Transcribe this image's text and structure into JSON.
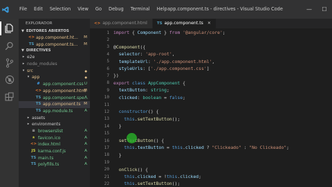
{
  "titlebar": {
    "menu": [
      "File",
      "Edit",
      "Selection",
      "View",
      "Go",
      "Debug",
      "Terminal",
      "Help"
    ],
    "window_title": "app.component.ts - directives - Visual Studio Code",
    "controls": {
      "minimize": "—",
      "maximize": "☐",
      "close": "✕"
    }
  },
  "activity": [
    "files-icon",
    "search-icon",
    "source-control-icon",
    "debug-icon",
    "extensions-icon"
  ],
  "sidebar": {
    "title": "EXPLORADOR",
    "open_editors": {
      "label": "EDITORES ABIERTOS",
      "items": [
        {
          "name": "app.component.ht...",
          "badge": "M",
          "icon": "<>",
          "icon_color": "#e37933",
          "name_color": "#e2c08d"
        },
        {
          "name": "app.component.ts...",
          "badge": "M",
          "icon": "TS",
          "icon_color": "#519aba",
          "name_color": "#e2c08d"
        }
      ]
    },
    "project": {
      "label": "DIRECTIVES",
      "items": [
        {
          "name": "e2e",
          "type": "folder",
          "depth": 1,
          "badge": "",
          "name_color": "#cccccc"
        },
        {
          "name": "node_modules",
          "type": "folder",
          "depth": 1,
          "badge": "",
          "name_color": "#8c8c8c"
        },
        {
          "name": "src",
          "type": "folder-open",
          "depth": 1,
          "badge": "",
          "name_color": "#e2c08d",
          "dot": true
        },
        {
          "name": "app",
          "type": "folder-open",
          "depth": 2,
          "badge": "",
          "name_color": "#e2c08d",
          "dot": true
        },
        {
          "name": "app.component.css",
          "type": "css",
          "depth": 3,
          "badge": "U",
          "name_color": "#73c991"
        },
        {
          "name": "app.component.html",
          "type": "html",
          "depth": 3,
          "badge": "M",
          "name_color": "#e2c08d"
        },
        {
          "name": "app.component.spe...",
          "type": "ts",
          "depth": 3,
          "badge": "A",
          "name_color": "#73c991"
        },
        {
          "name": "app.component.ts",
          "type": "ts",
          "depth": 3,
          "badge": "M",
          "name_color": "#e2c08d",
          "selected": true
        },
        {
          "name": "app.module.ts",
          "type": "ts",
          "depth": 3,
          "badge": "A",
          "name_color": "#73c991"
        },
        {
          "name": "assets",
          "type": "folder",
          "depth": 2,
          "badge": "",
          "name_color": "#cccccc"
        },
        {
          "name": "environments",
          "type": "folder",
          "depth": 2,
          "badge": "",
          "name_color": "#cccccc"
        },
        {
          "name": "browserslist",
          "type": "txt",
          "depth": 2,
          "badge": "A",
          "name_color": "#73c991"
        },
        {
          "name": "favicon.ico",
          "type": "img",
          "depth": 2,
          "badge": "A",
          "name_color": "#73c991"
        },
        {
          "name": "index.html",
          "type": "html",
          "depth": 2,
          "badge": "A",
          "name_color": "#73c991"
        },
        {
          "name": "karma.conf.js",
          "type": "js",
          "depth": 2,
          "badge": "A",
          "name_color": "#73c991"
        },
        {
          "name": "main.ts",
          "type": "ts",
          "depth": 2,
          "badge": "A",
          "name_color": "#73c991"
        },
        {
          "name": "polyfills.ts",
          "type": "ts",
          "depth": 2,
          "badge": "A",
          "name_color": "#73c991"
        }
      ]
    }
  },
  "tabs": [
    {
      "label": "app.component.html",
      "icon": "<>",
      "icon_color": "#e37933",
      "active": false,
      "close": ""
    },
    {
      "label": "app.component.ts",
      "icon": "TS",
      "icon_color": "#519aba",
      "active": true,
      "close": "✕"
    }
  ],
  "editor": {
    "current_line": 23,
    "lines": [
      [
        {
          "t": "import",
          "c": "ctl"
        },
        {
          "t": " { ",
          "c": "pun"
        },
        {
          "t": "Component",
          "c": "var"
        },
        {
          "t": " } ",
          "c": "pun"
        },
        {
          "t": "from",
          "c": "ctl"
        },
        {
          "t": " ",
          "c": "pun"
        },
        {
          "t": "'@angular/core'",
          "c": "str"
        },
        {
          "t": ";",
          "c": "pun"
        }
      ],
      [],
      [
        {
          "t": "@",
          "c": "pun"
        },
        {
          "t": "Component",
          "c": "dec"
        },
        {
          "t": "({",
          "c": "pun"
        }
      ],
      [
        {
          "t": "  selector",
          "c": "var"
        },
        {
          "t": ": ",
          "c": "pun"
        },
        {
          "t": "'app-root'",
          "c": "str"
        },
        {
          "t": ",",
          "c": "pun"
        }
      ],
      [
        {
          "t": "  templateUrl",
          "c": "var"
        },
        {
          "t": ": ",
          "c": "pun"
        },
        {
          "t": "'./app.component.html'",
          "c": "str"
        },
        {
          "t": ",",
          "c": "pun"
        }
      ],
      [
        {
          "t": "  styleUrls",
          "c": "var"
        },
        {
          "t": ": [",
          "c": "pun"
        },
        {
          "t": "'./app.component.css'",
          "c": "str"
        },
        {
          "t": "]",
          "c": "pun"
        }
      ],
      [
        {
          "t": "})",
          "c": "pun"
        }
      ],
      [
        {
          "t": "export",
          "c": "ctl"
        },
        {
          "t": " ",
          "c": "pun"
        },
        {
          "t": "class",
          "c": "kw"
        },
        {
          "t": " ",
          "c": "pun"
        },
        {
          "t": "AppComponent",
          "c": "typ"
        },
        {
          "t": " {",
          "c": "pun"
        }
      ],
      [
        {
          "t": "  textButton",
          "c": "var"
        },
        {
          "t": ": ",
          "c": "pun"
        },
        {
          "t": "string",
          "c": "typ"
        },
        {
          "t": ";",
          "c": "pun"
        }
      ],
      [
        {
          "t": "  clicked",
          "c": "var"
        },
        {
          "t": ": ",
          "c": "pun"
        },
        {
          "t": "boolean",
          "c": "typ"
        },
        {
          "t": " = ",
          "c": "pun"
        },
        {
          "t": "false",
          "c": "kw"
        },
        {
          "t": ";",
          "c": "pun"
        }
      ],
      [],
      [
        {
          "t": "  constructor",
          "c": "kw"
        },
        {
          "t": "() {",
          "c": "pun"
        }
      ],
      [
        {
          "t": "    this",
          "c": "kw"
        },
        {
          "t": ".",
          "c": "pun"
        },
        {
          "t": "setTextButton",
          "c": "fn"
        },
        {
          "t": "();",
          "c": "pun"
        }
      ],
      [
        {
          "t": "  }",
          "c": "pun"
        }
      ],
      [],
      [
        {
          "t": "  setTextButton",
          "c": "fn"
        },
        {
          "t": "() {",
          "c": "pun"
        }
      ],
      [
        {
          "t": "    this",
          "c": "kw"
        },
        {
          "t": ".",
          "c": "pun"
        },
        {
          "t": "textButton",
          "c": "var"
        },
        {
          "t": " = ",
          "c": "pun"
        },
        {
          "t": "this",
          "c": "kw"
        },
        {
          "t": ".",
          "c": "pun"
        },
        {
          "t": "clicked",
          "c": "var"
        },
        {
          "t": " ? ",
          "c": "pun"
        },
        {
          "t": "\"Clickeado\"",
          "c": "str"
        },
        {
          "t": " : ",
          "c": "pun"
        },
        {
          "t": "\"No Clickeado\"",
          "c": "str"
        },
        {
          "t": ";",
          "c": "pun"
        }
      ],
      [
        {
          "t": "  }",
          "c": "pun"
        }
      ],
      [],
      [
        {
          "t": "  onClick",
          "c": "fn"
        },
        {
          "t": "() {",
          "c": "pun"
        }
      ],
      [
        {
          "t": "    this",
          "c": "kw"
        },
        {
          "t": ".",
          "c": "pun"
        },
        {
          "t": "clicked",
          "c": "var"
        },
        {
          "t": " = !",
          "c": "pun"
        },
        {
          "t": "this",
          "c": "kw"
        },
        {
          "t": ".",
          "c": "pun"
        },
        {
          "t": "clicked",
          "c": "var"
        },
        {
          "t": ";",
          "c": "pun"
        }
      ],
      [
        {
          "t": "    this",
          "c": "kw"
        },
        {
          "t": ".",
          "c": "pun"
        },
        {
          "t": "setTextButton",
          "c": "fn"
        },
        {
          "t": "();",
          "c": "pun"
        }
      ],
      [
        {
          "t": "  }",
          "c": "pun"
        }
      ]
    ]
  }
}
